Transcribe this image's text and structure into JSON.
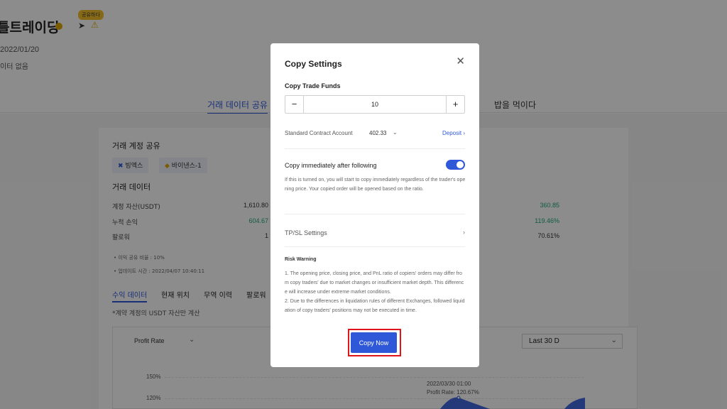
{
  "background": {
    "trader_name": "틀트레이딩",
    "badge": "공유하다",
    "join_date": "2022/01/20",
    "no_data_text": "이터 없음",
    "page_tabs": [
      {
        "label": "거래 데이터 공유",
        "active": true
      },
      {
        "label": "밥을 먹이다",
        "active": false
      }
    ],
    "account_share_title": "거래 계정 공유",
    "exchanges": [
      "빙엑스",
      "바이낸스-1"
    ],
    "trade_data_title": "거래 데이터",
    "stats": [
      {
        "label": "계정 자산(USDT)",
        "value": "1,610.80",
        "right_value": "360.85"
      },
      {
        "label": "누적 손익",
        "value": "604.67",
        "right_value": "119.46%"
      },
      {
        "label": "팔로워",
        "value": "1",
        "right_value": "70.61%"
      }
    ],
    "notes": [
      "이익 공유 비율 : 10%",
      "업데이트 시간 : 2022/04/07 10:40:11"
    ],
    "sub_tabs": [
      {
        "label": "수익 데이터",
        "active": true
      },
      {
        "label": "현재 위치",
        "active": false
      },
      {
        "label": "무역 이력",
        "active": false
      },
      {
        "label": "팔로워",
        "active": false
      }
    ],
    "usdt_note": "*계약 계정의 USDT 자산만 계산",
    "chart_metric": "Profit Rate",
    "range": "Last 30 D",
    "y_ticks": [
      "150%",
      "120%"
    ],
    "tooltip_date": "2022/03/30 01:00",
    "tooltip_rate": "Profit Rate: 120.67%"
  },
  "modal": {
    "title": "Copy Settings",
    "funds_label": "Copy Trade Funds",
    "funds_value": "10",
    "minus": "−",
    "plus": "+",
    "account_label": "Standard Contract Account",
    "account_value": "402.33",
    "deposit_label": "Deposit",
    "copy_immediately_label": "Copy immediately after following",
    "copy_immediately_on": true,
    "copy_immediately_desc": "If this is turned on, you will start to copy immediately regardless of the trader's opening price. Your copied order will be opened based on the ratio.",
    "tpsl_label": "TP/SL Settings",
    "risk_title": "Risk Warning",
    "risk_items": [
      "1. The opening price, closing price, and PnL ratio of copiers' orders may differ from copy traders' due to market changes or insufficient market depth. This difference will increase under extreme market conditions.",
      "2. Due to the differences in liquidation rules of different Exchanges, followed liquidation of copy traders' positions may not be executed in time."
    ],
    "copy_now_label": "Copy Now"
  },
  "colors": {
    "accent": "#2f58d9",
    "highlight_frame": "#e0141c",
    "positive": "#1fa67a",
    "badge": "#f5c02b"
  },
  "icons": [
    "close-icon",
    "minus-icon",
    "plus-icon",
    "chevron-down-icon",
    "chevron-right-icon",
    "share-icon",
    "warning-icon"
  ]
}
